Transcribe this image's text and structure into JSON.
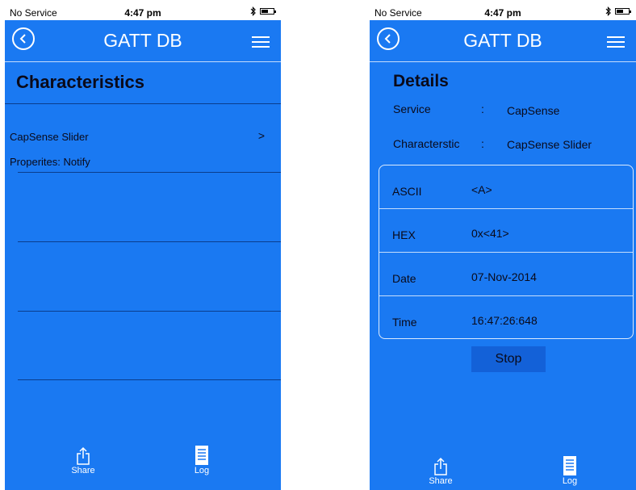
{
  "status": {
    "carrier": "No Service",
    "time": "4:47 pm"
  },
  "nav": {
    "title": "GATT DB"
  },
  "left": {
    "section_title": "Characteristics",
    "characteristic_name": "CapSense Slider",
    "chevron": ">",
    "properties": "Properites: Notify"
  },
  "right": {
    "details_title": "Details",
    "service_label": "Service",
    "service_value": "CapSense",
    "characteristic_label": "Characterstic",
    "characteristic_value": "CapSense Slider",
    "colon": ":",
    "rows": [
      {
        "label": "ASCII",
        "value": "<A>"
      },
      {
        "label": "HEX",
        "value": "0x<41>"
      },
      {
        "label": "Date",
        "value": "07-Nov-2014"
      },
      {
        "label": "Time",
        "value": "16:47:26:648"
      }
    ],
    "stop_label": "Stop"
  },
  "tabbar": {
    "share_label": "Share",
    "log_label": "Log"
  },
  "colors": {
    "background": "#1a79f2",
    "divider": "#0b3d8c",
    "button": "#1361d8"
  },
  "icons": [
    "back-icon",
    "menu-icon",
    "bluetooth-icon",
    "battery-icon",
    "share-icon",
    "log-icon"
  ]
}
